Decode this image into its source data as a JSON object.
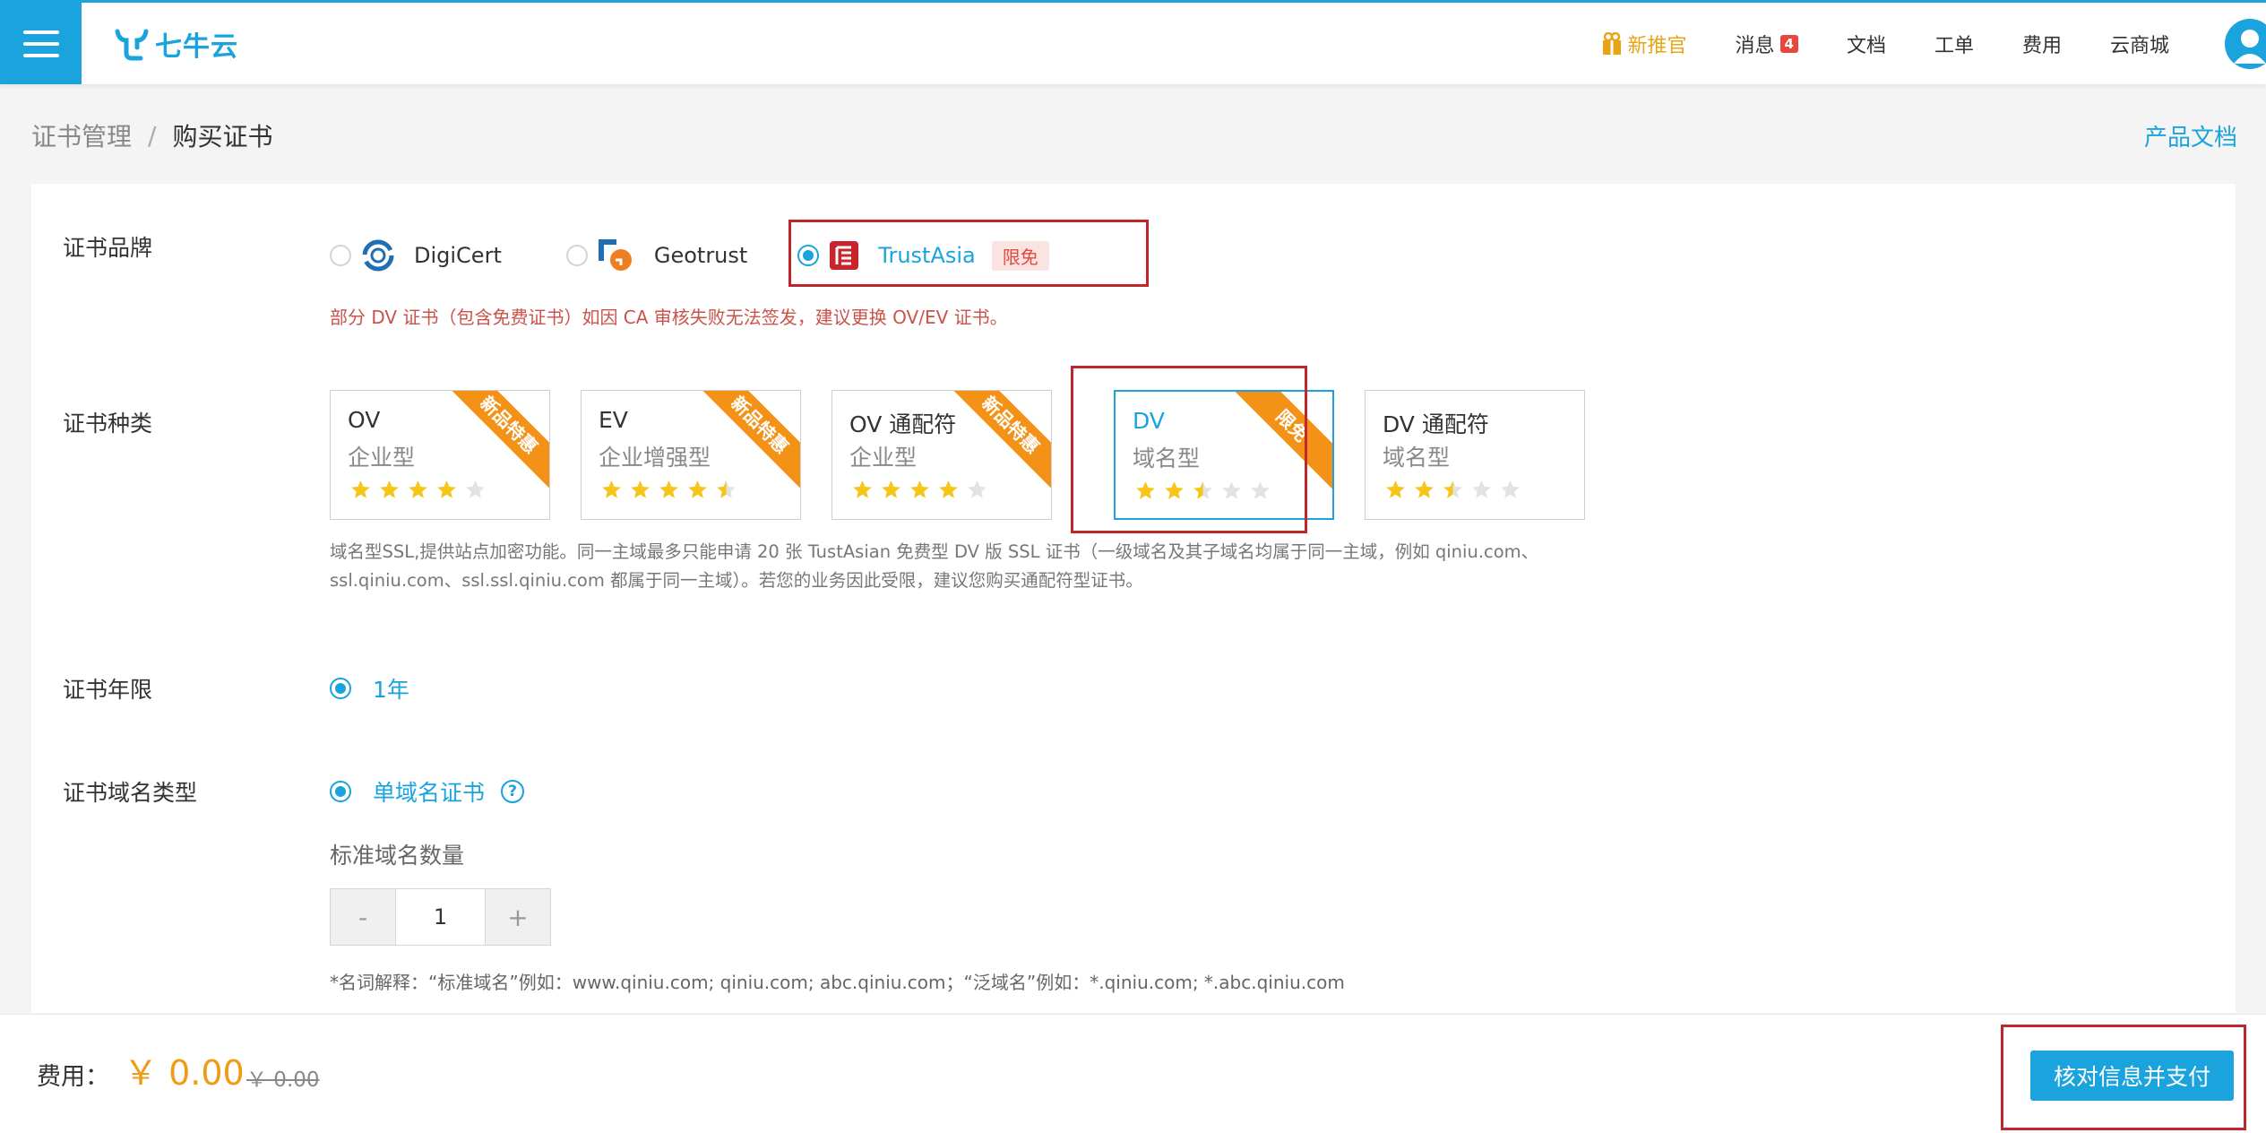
{
  "header": {
    "brand": "七牛云",
    "nav": {
      "promo": "新推官",
      "messages": "消息",
      "messages_count": "4",
      "docs": "文档",
      "tickets": "工单",
      "billing": "费用",
      "market": "云商城"
    }
  },
  "breadcrumb": {
    "parent": "证书管理",
    "separator": "/",
    "current": "购买证书"
  },
  "doc_link": "产品文档",
  "brand_section": {
    "label": "证书品牌",
    "options": [
      {
        "name": "DigiCert",
        "selected": false
      },
      {
        "name": "Geotrust",
        "selected": false
      },
      {
        "name": "TrustAsia",
        "selected": true,
        "tag": "限免"
      }
    ],
    "warning": "部分 DV 证书（包含免费证书）如因 CA 审核失败无法签发，建议更换 OV/EV 证书。"
  },
  "type_section": {
    "label": "证书种类",
    "cards": [
      {
        "title": "OV",
        "subtitle": "企业型",
        "ribbon": "新品特惠",
        "rating": 4,
        "selected": false
      },
      {
        "title": "EV",
        "subtitle": "企业增强型",
        "ribbon": "新品特惠",
        "rating": 4.5,
        "selected": false
      },
      {
        "title": "OV 通配符",
        "subtitle": "企业型",
        "ribbon": "新品特惠",
        "rating": 4,
        "selected": false
      },
      {
        "title": "DV",
        "subtitle": "域名型",
        "ribbon": "限免",
        "rating": 2.5,
        "selected": true
      },
      {
        "title": "DV 通配符",
        "subtitle": "域名型",
        "ribbon": "",
        "rating": 2.5,
        "selected": false
      }
    ],
    "description": "域名型SSL,提供站点加密功能。同一主域最多只能申请 20 张 TustAsian 免费型 DV 版 SSL 证书（一级域名及其子域名均属于同一主域，例如 qiniu.com、ssl.qiniu.com、ssl.ssl.qiniu.com 都属于同一主域）。若您的业务因此受限，建议您购买通配符型证书。"
  },
  "year_section": {
    "label": "证书年限",
    "option": "1年"
  },
  "domain_section": {
    "label": "证书域名类型",
    "option": "单域名证书",
    "help_icon": "?",
    "quantity_label": "标准域名数量",
    "minus": "-",
    "quantity": "1",
    "plus": "+",
    "note": "*名词解释：“标准域名”例如：www.qiniu.com; qiniu.com; abc.qiniu.com；“泛域名”例如：*.qiniu.com; *.abc.qiniu.com"
  },
  "footer": {
    "fee_label": "费用：",
    "price": "￥ 0.00",
    "original_price": "￥ 0.00",
    "pay_button": "核对信息并支付"
  },
  "colors": {
    "accent": "#1aa3dd",
    "ribbon": "#f39216",
    "highlight": "#c0272d",
    "price": "#f09b17",
    "star": "#f5c518"
  }
}
